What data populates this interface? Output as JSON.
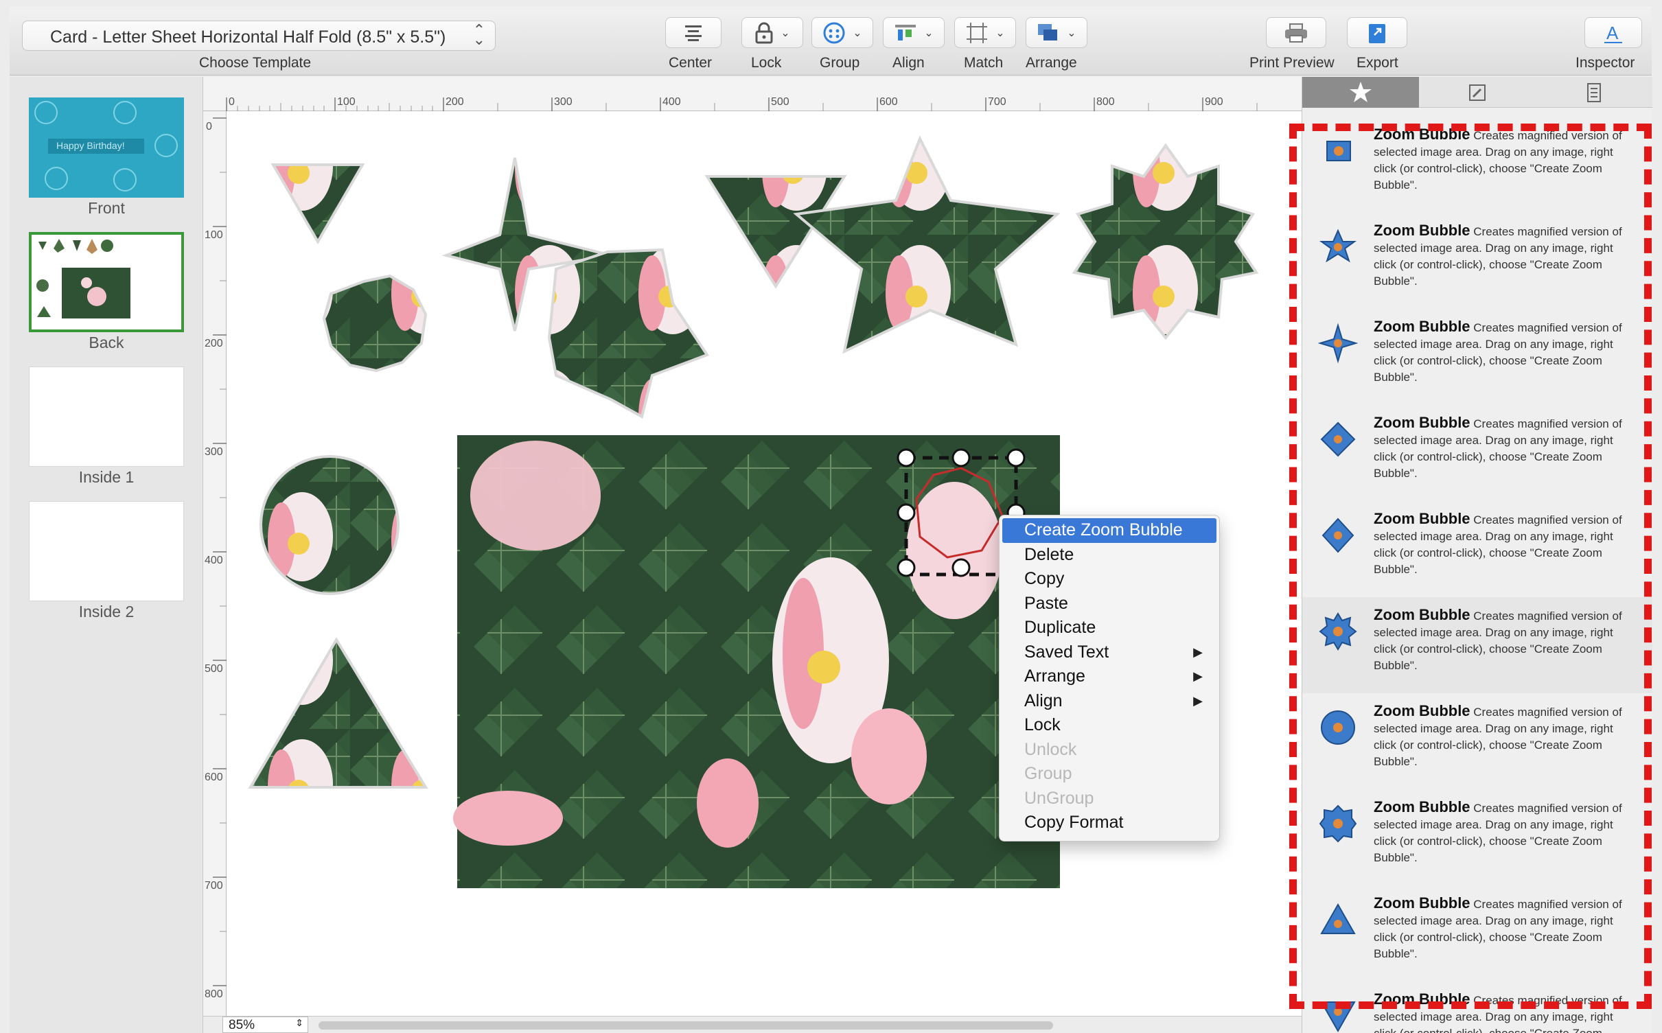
{
  "toolbar": {
    "template_value": "Card - Letter Sheet Horizontal Half Fold (8.5\" x 5.5\")",
    "template_caption": "Choose Template",
    "buttons": {
      "center": "Center",
      "lock": "Lock",
      "group": "Group",
      "align": "Align",
      "match": "Match",
      "arrange": "Arrange",
      "print_preview": "Print Preview",
      "export": "Export",
      "inspector": "Inspector"
    }
  },
  "pages": [
    {
      "label": "Front",
      "thumb_text": "Happy Birthday!"
    },
    {
      "label": "Back"
    },
    {
      "label": "Inside 1"
    },
    {
      "label": "Inside 2"
    }
  ],
  "ruler": {
    "horizontal": [
      "0",
      "100",
      "200",
      "300",
      "400",
      "500",
      "600",
      "700",
      "800",
      "900"
    ],
    "vertical": [
      "0",
      "100",
      "200",
      "300",
      "400",
      "500",
      "600",
      "700",
      "800"
    ]
  },
  "zoom": "85%",
  "context_menu": {
    "items": [
      {
        "label": "Create Zoom Bubble",
        "state": "highlighted"
      },
      {
        "label": "Delete",
        "state": "enabled"
      },
      {
        "label": "Copy",
        "state": "enabled"
      },
      {
        "label": "Paste",
        "state": "enabled"
      },
      {
        "label": "Duplicate",
        "state": "enabled"
      },
      {
        "label": "Saved Text",
        "state": "submenu"
      },
      {
        "label": "Arrange",
        "state": "submenu"
      },
      {
        "label": "Align",
        "state": "submenu"
      },
      {
        "label": "Lock",
        "state": "enabled"
      },
      {
        "label": "Unlock",
        "state": "disabled"
      },
      {
        "label": "Group",
        "state": "disabled"
      },
      {
        "label": "UnGroup",
        "state": "disabled"
      },
      {
        "label": "Copy Format",
        "state": "enabled"
      }
    ]
  },
  "inspector": {
    "item_title": "Zoom Bubble",
    "item_desc": "Creates magnified version of selected image area.  Drag on any image, right click (or control-click), choose \"Create Zoom Bubble\".",
    "item_shapes": [
      "square",
      "star",
      "diamond",
      "diamond",
      "diamond",
      "badge",
      "circle",
      "badge",
      "triangle",
      "triangle-down"
    ]
  },
  "colors": {
    "accent_blue": "#3a78d8",
    "highlight_red": "#e01818",
    "selected_green": "#3a9a3a",
    "leaf_green": "#2c4a31",
    "petal_pink": "#f2a7b3"
  }
}
